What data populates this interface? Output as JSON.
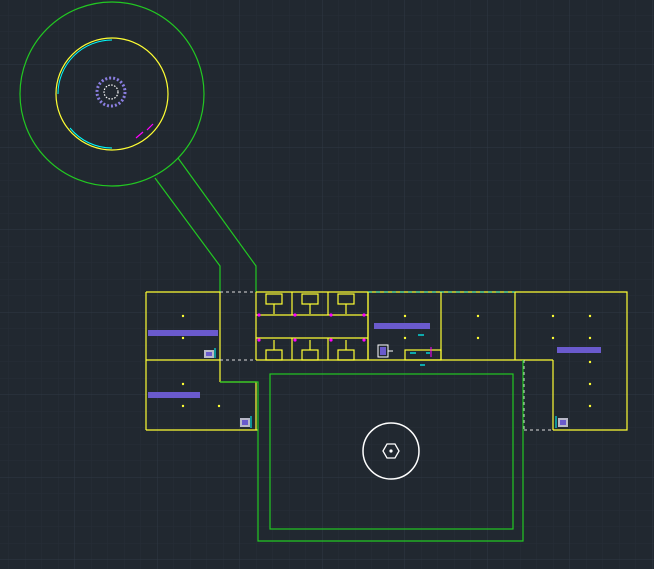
{
  "app": {
    "background_color": "#212830",
    "grid_minor_color": "#27303a",
    "grid_major_color": "#2e3843"
  },
  "colors": {
    "site_outline": "#22c822",
    "wall": "#ffff33",
    "hatch_blue": "#6a5acd",
    "cyan": "#00ffff",
    "magenta": "#ff00ff",
    "white": "#ffffff",
    "grey": "#b8b8c8"
  },
  "icons": {
    "ucs": "hexagon-marker-icon",
    "equipment": "equipment-block-icon",
    "cylinder": "cylinder-plan-icon"
  }
}
